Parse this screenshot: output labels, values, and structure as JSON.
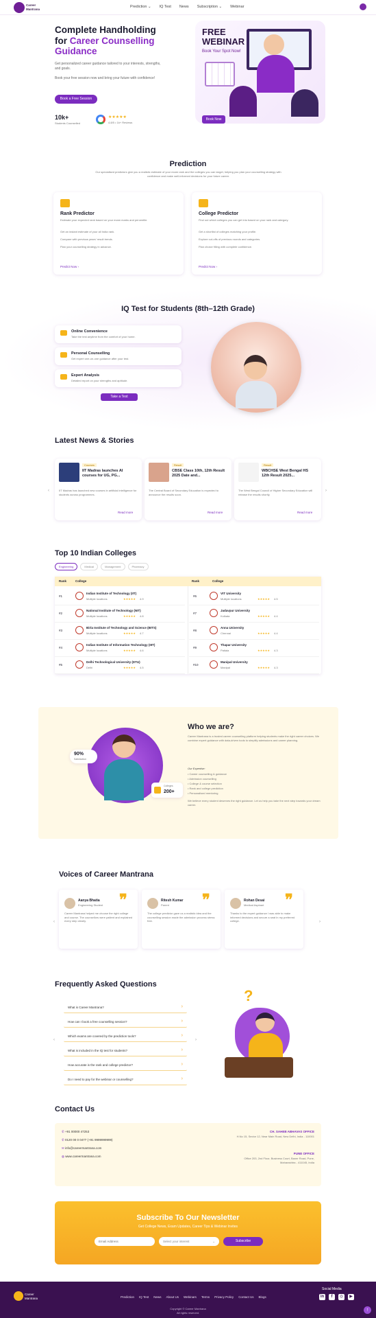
{
  "nav": {
    "logo_text": "Career Mantrana",
    "links": [
      "Prediction ⌄",
      "IQ Test",
      "News",
      "Subscription ⌄",
      "Webinar"
    ]
  },
  "hero": {
    "title_a": "Complete Handholding",
    "title_b": "for ",
    "title_c": "Career Counselling Guidance",
    "desc": "Get personalized career guidance tailored to your interests, strengths, and goals.",
    "note": "Book your free session now and bring your future with confidence!",
    "cta": "Book a Free Session",
    "stat1_value": "10k+",
    "stat1_label": "Students Counselled",
    "stat2_label": "4.8/5 • 1k+ Reviews",
    "stars": "★★★★★",
    "webinar_title": "FREE WEBINAR",
    "webinar_sub": "Book Your Spot Now!",
    "webinar_btn": "Book Now"
  },
  "prediction": {
    "title": "Prediction",
    "desc": "Our specialised predictors give you a realistic estimate of your exam rank and the colleges you can target, helping you plan your counselling strategy with confidence and make well-informed decisions for your future career.",
    "cards": [
      {
        "title": "Rank Predictor",
        "desc": "Estimate your expected rank based on your exam marks and percentile.",
        "points": [
          "Get an instant estimate of your all India rank.",
          "Compare with previous years' result trends.",
          "Plan your counselling strategy in advance."
        ],
        "link": "Predict Now ›"
      },
      {
        "title": "College Predictor",
        "desc": "Find out which colleges you can get into based on your rank and category.",
        "points": [
          "Get a shortlist of colleges matching your profile.",
          "Explore cut-offs of previous rounds and categories.",
          "Plan choice filling with complete confidence."
        ],
        "link": "Predict Now ›"
      }
    ]
  },
  "iq": {
    "title": "IQ Test for Students (8th–12th Grade)",
    "items": [
      {
        "title": "Online Convenience",
        "desc": "Take the test anytime from the comfort of your home."
      },
      {
        "title": "Personal Counselling",
        "desc": "Get expert one-on-one guidance after your test."
      },
      {
        "title": "Expert Analysis",
        "desc": "Detailed report on your strengths and aptitude."
      }
    ],
    "btn": "Take a Test"
  },
  "news": {
    "title": "Latest News & Stories",
    "items": [
      {
        "tag": "Courses",
        "headline": "IIT Madras launches AI courses for UG, PG...",
        "desc": "IIT Madras has launched new courses in artificial intelligence for students across programmes.",
        "link": "Read more"
      },
      {
        "tag": "Result",
        "headline": "CBSE Class 10th, 12th Result 2025 Date and...",
        "desc": "The Central Board of Secondary Education is expected to announce the results soon.",
        "link": "Read more"
      },
      {
        "tag": "Result",
        "headline": "WBCHSE West Bengal HS 12th Result 2025...",
        "desc": "The West Bengal Council of Higher Secondary Education will release the results shortly.",
        "link": "Read more"
      }
    ]
  },
  "colleges": {
    "title": "Top 10 Indian Colleges",
    "tabs": [
      "Engineering",
      "Medical",
      "Management",
      "Pharmacy"
    ],
    "col_rank": "Rank",
    "col_college": "College",
    "left": [
      {
        "rank": "#1",
        "name": "Indian Institute of Technology (IIT)",
        "loc": "Multiple locations",
        "rating": "4.9"
      },
      {
        "rank": "#2",
        "name": "National Institute of Technology (NIT)",
        "loc": "Multiple locations",
        "rating": "4.8"
      },
      {
        "rank": "#3",
        "name": "Birla Institute of Technology and Science (BITS)",
        "loc": "Multiple locations",
        "rating": "4.7"
      },
      {
        "rank": "#4",
        "name": "Indian Institute of Information Technology (IIIT)",
        "loc": "Multiple locations",
        "rating": "4.6"
      },
      {
        "rank": "#5",
        "name": "Delhi Technological University (DTU)",
        "loc": "Delhi",
        "rating": "4.5"
      }
    ],
    "right": [
      {
        "rank": "#6",
        "name": "VIT University",
        "loc": "Multiple locations",
        "rating": "4.5"
      },
      {
        "rank": "#7",
        "name": "Jadavpur University",
        "loc": "Kolkata",
        "rating": "4.4"
      },
      {
        "rank": "#8",
        "name": "Anna University",
        "loc": "Chennai",
        "rating": "4.4"
      },
      {
        "rank": "#9",
        "name": "Thapar University",
        "loc": "Patiala",
        "rating": "4.3"
      },
      {
        "rank": "#10",
        "name": "Manipal University",
        "loc": "Manipal",
        "rating": "4.3"
      }
    ]
  },
  "about": {
    "title": "Who we are?",
    "desc": "Career Mantrana is a trusted career counselling platform helping students make the right career choices. We combine expert guidance with data-driven tools to simplify admissions and career planning.",
    "expertise_title": "Our Expertise:",
    "points": [
      "• Career counselling & guidance",
      "• Admission counselling",
      "• College & course selection",
      "• Rank and college prediction",
      "• Personalised mentoring"
    ],
    "closing": "We believe every student deserves the right guidance. Let us help you take the next step towards your dream career.",
    "stat1": "90%",
    "stat1_label": "Satisfaction",
    "stat2": "200+",
    "stat2_label": "Colleges"
  },
  "testimonials": {
    "title": "Voices of Career Mantrana",
    "items": [
      {
        "name": "Aanya Bhatia",
        "role": "Engineering Student",
        "text": "Career Mantrana helped me choose the right college and course. The counsellors were patient and explained every step clearly."
      },
      {
        "name": "Ritesh Kumar",
        "role": "Parent",
        "text": "The college predictor gave us a realistic idea and the counselling session made the admission process stress free."
      },
      {
        "name": "Rohan Desai",
        "role": "Medical Aspirant",
        "text": "Thanks to the expert guidance I was able to make informed decisions and secure a seat in my preferred college."
      }
    ]
  },
  "faq": {
    "title": "Frequently Asked Questions",
    "items": [
      "What is Career Mantrana?",
      "How can I book a free counselling session?",
      "Which exams are covered by the prediction tools?",
      "What is included in the IQ test for students?",
      "How accurate is the rank and college predictor?",
      "Do I need to pay for the webinar or counselling?"
    ]
  },
  "contact": {
    "title": "Contact Us",
    "items": [
      "+91 00000 47253",
      "0120 00 0 0477 (+91 9999999999)",
      "info@careermantrana.com",
      "www.careermantrana.com"
    ],
    "office1_title": "CH. SAHEB ABHAVAS OFFICE",
    "office1_addr": "H.No 15, Sector 12, Near Main Road, New Delhi, India - 110001",
    "office2_title": "PUNE OFFICE",
    "office2_addr": "Office 203, 2nd Floor, Business Court, Baner Road, Pune, Maharashtra - 411045, India"
  },
  "newsletter": {
    "title": "Subscribe To Our Newsletter",
    "desc": "Get College News, Exam Updates, Career Tips & Webinar Invites",
    "placeholder_email": "Email Address",
    "placeholder_select": "Select your interest",
    "btn": "Subscribe"
  },
  "footer": {
    "logo_text": "Career Mantrana",
    "links": [
      "Prediction",
      "IQ Test",
      "News",
      "About Us",
      "Webinars",
      "Terms",
      "Privacy Policy",
      "Contact Us",
      "Blogs"
    ],
    "social_title": "Social Media",
    "copyright": "Copyright © Career Mantrana",
    "rights": "All rights reserved."
  },
  "colors": {
    "primary": "#7b2cbf",
    "accent": "#f5b41a",
    "footer": "#3a1150"
  }
}
